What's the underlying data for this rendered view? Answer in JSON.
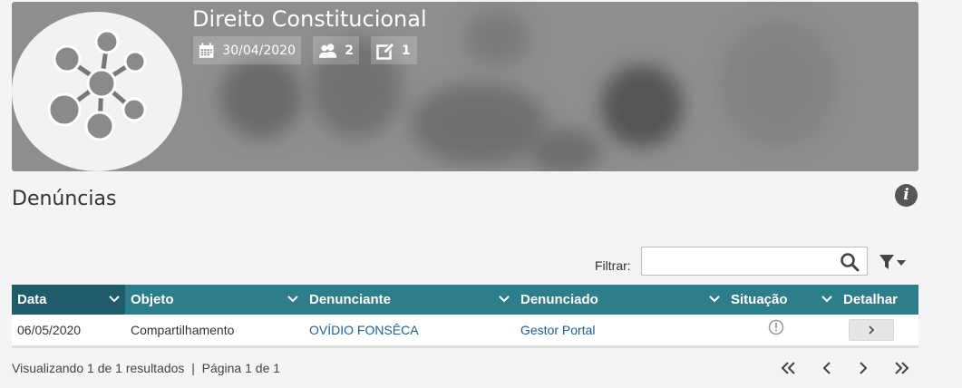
{
  "course": {
    "title": "Direito Constitucional",
    "date": "30/04/2020",
    "participants": "2",
    "posts": "1"
  },
  "section": {
    "title": "Denúncias"
  },
  "filter": {
    "label": "Filtrar:",
    "value": "",
    "placeholder": ""
  },
  "table": {
    "columns": [
      "Data",
      "Objeto",
      "Denunciante",
      "Denunciado",
      "Situação",
      "Detalhar"
    ],
    "rows": [
      {
        "data": "06/05/2020",
        "objeto": "Compartilhamento",
        "denunciante": "OVÍDIO FONSÊCA",
        "denunciado": "Gestor Portal"
      }
    ]
  },
  "footer": {
    "info": "Visualizando 1 de 1 resultados  |  Página 1 de 1"
  },
  "colors": {
    "header": "#2e7d8b",
    "header_active": "#1d5c68",
    "link": "#1f5f8c"
  },
  "icons": [
    "calendar-icon",
    "users-icon",
    "edit-icon",
    "info-icon",
    "search-icon",
    "filter-icon",
    "status-icon",
    "chevron-right-icon",
    "first-page-icon",
    "prev-page-icon",
    "next-page-icon",
    "last-page-icon"
  ]
}
